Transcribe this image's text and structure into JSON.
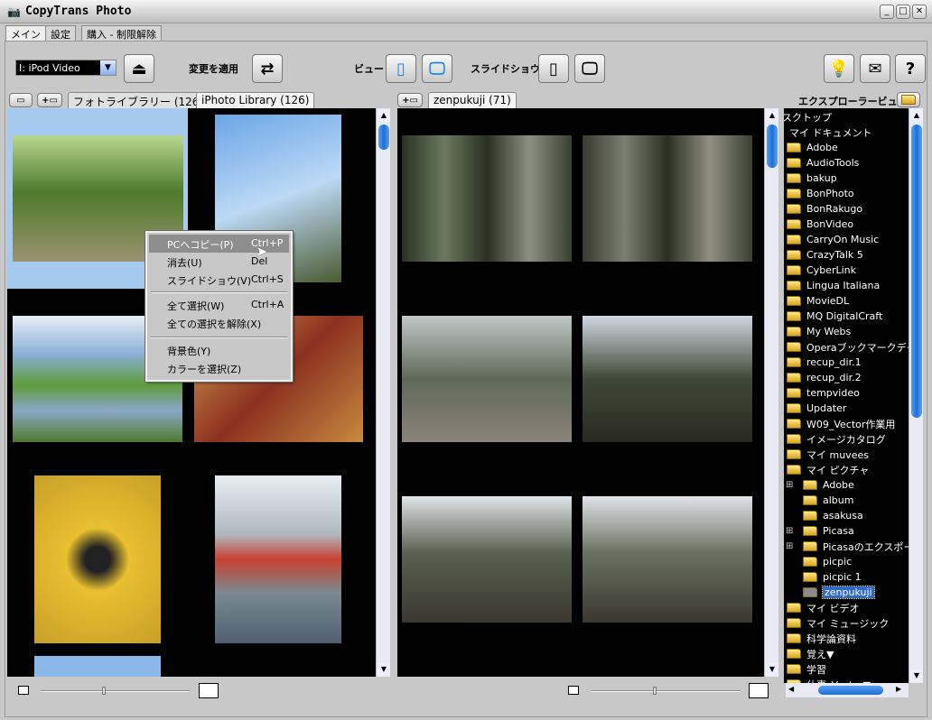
{
  "window": {
    "title": "CopyTrans Photo",
    "min": "_",
    "max": "□",
    "close": "✕"
  },
  "menu_tabs": [
    "メイン",
    "設定",
    "購入 - 制限解除"
  ],
  "toolbar": {
    "device": "I: iPod Video",
    "apply_label": "変更を適用",
    "view_label": "ビュー",
    "slideshow_label": "スライドショウ",
    "explorer_label": "エクスプローラービュー"
  },
  "left_panel": {
    "tabs": [
      "フォトライブラリー (126)",
      "iPhoto Library (126)"
    ]
  },
  "middle_panel": {
    "tab": "zenpukuji (71)"
  },
  "context_menu": {
    "items": [
      {
        "label": "PCへコピー(P)",
        "shortcut": "Ctrl+P"
      },
      {
        "label": "消去(U)",
        "shortcut": "Del"
      },
      {
        "label": "スライドショウ(V)",
        "shortcut": "Ctrl+S"
      },
      {
        "label": "全て選択(W)",
        "shortcut": "Ctrl+A"
      },
      {
        "label": "全ての選択を解除(X)",
        "shortcut": ""
      },
      {
        "label": "背景色(Y)",
        "shortcut": ""
      },
      {
        "label": "カラーを選択(Z)",
        "shortcut": ""
      }
    ]
  },
  "tree": {
    "items": [
      "スクトップ",
      "マイ ドキュメント",
      "Adobe",
      "AudioTools",
      "bakup",
      "BonPhoto",
      "BonRakugo",
      "BonVideo",
      "CarryOn Music",
      "CrazyTalk 5",
      "CyberLink",
      "Lingua Italiana",
      "MovieDL",
      "MQ DigitalCraft",
      "My Webs",
      "Operaブックマークデータ",
      "recup_dir.1",
      "recup_dir.2",
      "tempvideo",
      "Updater",
      "W09_Vector作業用",
      "イメージカタログ",
      "マイ muvees",
      "マイ ピクチャ",
      "Adobe",
      "album",
      "asakusa",
      "Picasa",
      "Picasaのエクスポート済",
      "picpic",
      "picpic 1",
      "zenpukuji",
      "マイ ビデオ",
      "マイ ミュージック",
      "科学論資料",
      "覚え▼",
      "学習",
      "仕事_Vector▼"
    ],
    "selected": "zenpukuji"
  },
  "colors": {
    "selection": "#316ac5",
    "thumb_selected_bg": "#a6caf0",
    "panel_bg": "#000000"
  }
}
